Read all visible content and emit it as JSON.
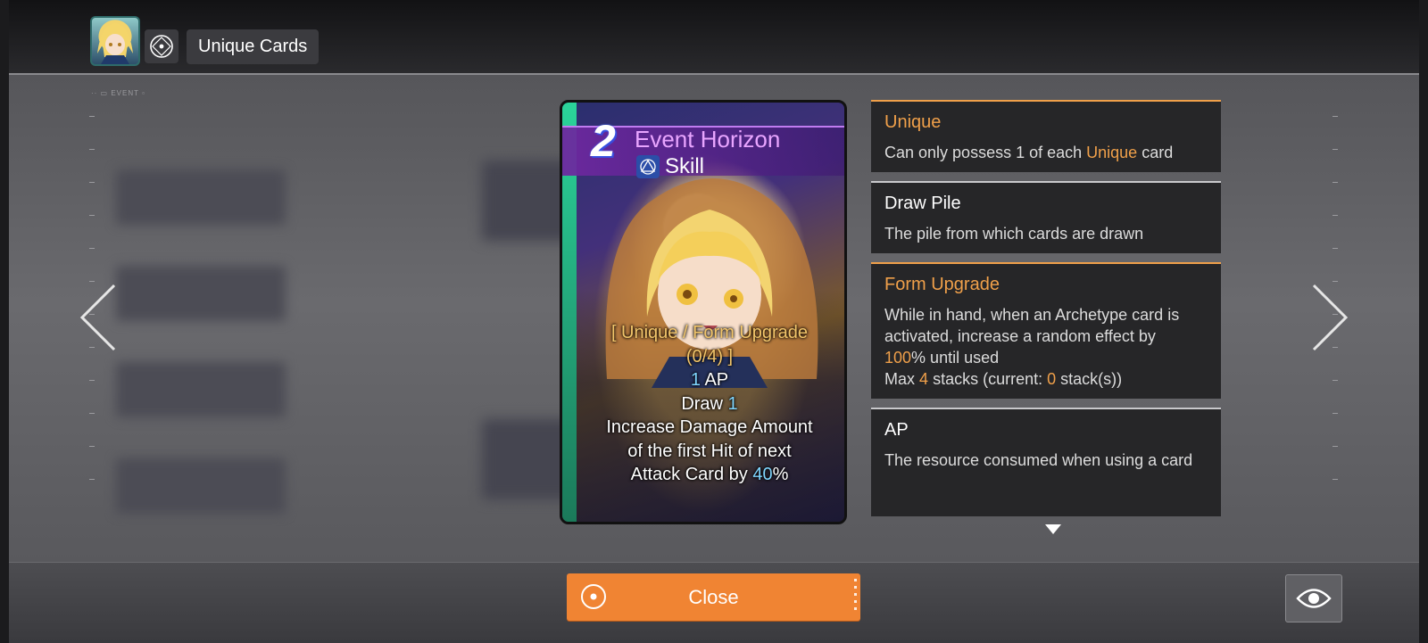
{
  "header": {
    "title": "Unique Cards",
    "avatar_icon": "character-portrait",
    "menu_icon": "target-icon"
  },
  "background": {
    "tiny_label": "EVENT"
  },
  "card": {
    "cost": "2",
    "name": "Event Horizon",
    "type": "Skill",
    "type_icon": "skill-icon",
    "tags_line1": "[ Unique / Form Upgrade",
    "tags_line2": "(0/4) ]",
    "ap_value": "1",
    "ap_unit": "AP",
    "draw_label": "Draw",
    "draw_value": "1",
    "effect_line1": "Increase Damage Amount",
    "effect_line2": "of the first Hit of next",
    "effect_prefix": "Attack Card by",
    "effect_value": "40",
    "effect_suffix": "%"
  },
  "info": {
    "unique": {
      "title": "Unique",
      "desc_prefix": "Can only possess 1 of each",
      "desc_highlight": "Unique",
      "desc_suffix": "card"
    },
    "draw_pile": {
      "title": "Draw Pile",
      "desc": "The pile from which cards are drawn"
    },
    "form_upgrade": {
      "title": "Form Upgrade",
      "desc_line": "While in hand, when an Archetype card is activated, increase a random effect by",
      "pct_value": "100",
      "pct_suffix": "% until used",
      "max_prefix": "Max",
      "max_value": "4",
      "max_mid": "stacks (current:",
      "current_value": "0",
      "max_suffix": "stack(s))"
    },
    "ap": {
      "title": "AP",
      "desc": "The resource consumed when using a card"
    }
  },
  "footer": {
    "close_label": "Close",
    "eye_icon": "eye-icon"
  },
  "colors": {
    "accent_orange": "#f08433",
    "highlight_orange": "#f0a04a",
    "card_name": "#e9a5ff",
    "value_blue": "#7fd6ff"
  }
}
